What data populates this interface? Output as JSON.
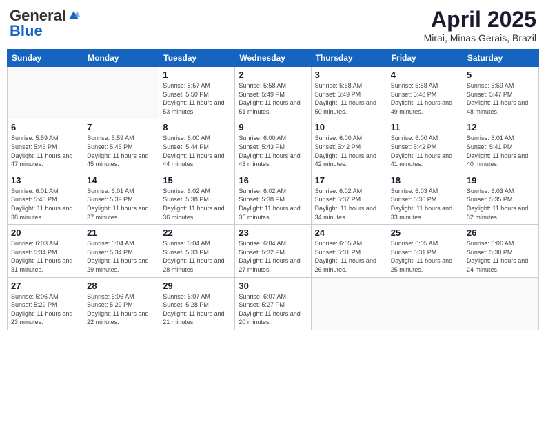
{
  "header": {
    "logo_general": "General",
    "logo_blue": "Blue",
    "month_year": "April 2025",
    "location": "Mirai, Minas Gerais, Brazil"
  },
  "days_of_week": [
    "Sunday",
    "Monday",
    "Tuesday",
    "Wednesday",
    "Thursday",
    "Friday",
    "Saturday"
  ],
  "weeks": [
    [
      {
        "day": "",
        "detail": ""
      },
      {
        "day": "",
        "detail": ""
      },
      {
        "day": "1",
        "detail": "Sunrise: 5:57 AM\nSunset: 5:50 PM\nDaylight: 11 hours and 53 minutes."
      },
      {
        "day": "2",
        "detail": "Sunrise: 5:58 AM\nSunset: 5:49 PM\nDaylight: 11 hours and 51 minutes."
      },
      {
        "day": "3",
        "detail": "Sunrise: 5:58 AM\nSunset: 5:49 PM\nDaylight: 11 hours and 50 minutes."
      },
      {
        "day": "4",
        "detail": "Sunrise: 5:58 AM\nSunset: 5:48 PM\nDaylight: 11 hours and 49 minutes."
      },
      {
        "day": "5",
        "detail": "Sunrise: 5:59 AM\nSunset: 5:47 PM\nDaylight: 11 hours and 48 minutes."
      }
    ],
    [
      {
        "day": "6",
        "detail": "Sunrise: 5:59 AM\nSunset: 5:46 PM\nDaylight: 11 hours and 47 minutes."
      },
      {
        "day": "7",
        "detail": "Sunrise: 5:59 AM\nSunset: 5:45 PM\nDaylight: 11 hours and 45 minutes."
      },
      {
        "day": "8",
        "detail": "Sunrise: 6:00 AM\nSunset: 5:44 PM\nDaylight: 11 hours and 44 minutes."
      },
      {
        "day": "9",
        "detail": "Sunrise: 6:00 AM\nSunset: 5:43 PM\nDaylight: 11 hours and 43 minutes."
      },
      {
        "day": "10",
        "detail": "Sunrise: 6:00 AM\nSunset: 5:42 PM\nDaylight: 11 hours and 42 minutes."
      },
      {
        "day": "11",
        "detail": "Sunrise: 6:00 AM\nSunset: 5:42 PM\nDaylight: 11 hours and 41 minutes."
      },
      {
        "day": "12",
        "detail": "Sunrise: 6:01 AM\nSunset: 5:41 PM\nDaylight: 11 hours and 40 minutes."
      }
    ],
    [
      {
        "day": "13",
        "detail": "Sunrise: 6:01 AM\nSunset: 5:40 PM\nDaylight: 11 hours and 38 minutes."
      },
      {
        "day": "14",
        "detail": "Sunrise: 6:01 AM\nSunset: 5:39 PM\nDaylight: 11 hours and 37 minutes."
      },
      {
        "day": "15",
        "detail": "Sunrise: 6:02 AM\nSunset: 5:38 PM\nDaylight: 11 hours and 36 minutes."
      },
      {
        "day": "16",
        "detail": "Sunrise: 6:02 AM\nSunset: 5:38 PM\nDaylight: 11 hours and 35 minutes."
      },
      {
        "day": "17",
        "detail": "Sunrise: 6:02 AM\nSunset: 5:37 PM\nDaylight: 11 hours and 34 minutes."
      },
      {
        "day": "18",
        "detail": "Sunrise: 6:03 AM\nSunset: 5:36 PM\nDaylight: 11 hours and 33 minutes."
      },
      {
        "day": "19",
        "detail": "Sunrise: 6:03 AM\nSunset: 5:35 PM\nDaylight: 11 hours and 32 minutes."
      }
    ],
    [
      {
        "day": "20",
        "detail": "Sunrise: 6:03 AM\nSunset: 5:34 PM\nDaylight: 11 hours and 31 minutes."
      },
      {
        "day": "21",
        "detail": "Sunrise: 6:04 AM\nSunset: 5:34 PM\nDaylight: 11 hours and 29 minutes."
      },
      {
        "day": "22",
        "detail": "Sunrise: 6:04 AM\nSunset: 5:33 PM\nDaylight: 11 hours and 28 minutes."
      },
      {
        "day": "23",
        "detail": "Sunrise: 6:04 AM\nSunset: 5:32 PM\nDaylight: 11 hours and 27 minutes."
      },
      {
        "day": "24",
        "detail": "Sunrise: 6:05 AM\nSunset: 5:31 PM\nDaylight: 11 hours and 26 minutes."
      },
      {
        "day": "25",
        "detail": "Sunrise: 6:05 AM\nSunset: 5:31 PM\nDaylight: 11 hours and 25 minutes."
      },
      {
        "day": "26",
        "detail": "Sunrise: 6:06 AM\nSunset: 5:30 PM\nDaylight: 11 hours and 24 minutes."
      }
    ],
    [
      {
        "day": "27",
        "detail": "Sunrise: 6:06 AM\nSunset: 5:29 PM\nDaylight: 11 hours and 23 minutes."
      },
      {
        "day": "28",
        "detail": "Sunrise: 6:06 AM\nSunset: 5:29 PM\nDaylight: 11 hours and 22 minutes."
      },
      {
        "day": "29",
        "detail": "Sunrise: 6:07 AM\nSunset: 5:28 PM\nDaylight: 11 hours and 21 minutes."
      },
      {
        "day": "30",
        "detail": "Sunrise: 6:07 AM\nSunset: 5:27 PM\nDaylight: 11 hours and 20 minutes."
      },
      {
        "day": "",
        "detail": ""
      },
      {
        "day": "",
        "detail": ""
      },
      {
        "day": "",
        "detail": ""
      }
    ]
  ]
}
